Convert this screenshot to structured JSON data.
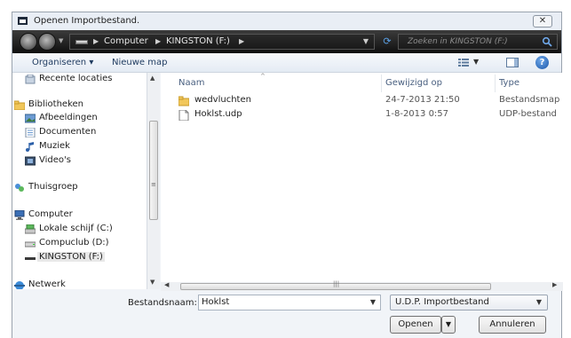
{
  "window": {
    "title": "Openen Importbestand.",
    "close_label": "✕"
  },
  "address": {
    "segments": [
      "Computer",
      "KINGSTON (F:)"
    ],
    "search_placeholder": "Zoeken in KINGSTON (F:)"
  },
  "toolbar": {
    "organize_label": "Organiseren ▾",
    "new_folder_label": "Nieuwe map"
  },
  "nav": {
    "items": [
      {
        "label": "Recente locaties",
        "icon": "recent-places-icon"
      },
      {
        "label": "Bibliotheken",
        "icon": "libraries-icon"
      },
      {
        "label": "Afbeeldingen",
        "icon": "pictures-icon"
      },
      {
        "label": "Documenten",
        "icon": "documents-icon"
      },
      {
        "label": "Muziek",
        "icon": "music-icon"
      },
      {
        "label": "Video's",
        "icon": "videos-icon"
      },
      {
        "label": "Thuisgroep",
        "icon": "homegroup-icon"
      },
      {
        "label": "Computer",
        "icon": "computer-icon"
      },
      {
        "label": "Lokale schijf (C:)",
        "icon": "local-disk-icon"
      },
      {
        "label": "Compuclub (D:)",
        "icon": "drive-icon"
      },
      {
        "label": "KINGSTON (F:)",
        "icon": "usb-drive-icon"
      },
      {
        "label": "Netwerk",
        "icon": "network-icon"
      }
    ]
  },
  "files": {
    "columns": [
      "Naam",
      "Gewijzigd op",
      "Type"
    ],
    "rows": [
      {
        "name": "wedvluchten",
        "modified": "24-7-2013 21:50",
        "type": "Bestandsmap",
        "icon": "folder-icon"
      },
      {
        "name": "Hoklst.udp",
        "modified": "1-8-2013 0:57",
        "type": "UDP-bestand",
        "icon": "file-icon"
      }
    ]
  },
  "footer": {
    "filename_label": "Bestandsnaam:",
    "filename_value": "Hoklst",
    "filetype_value": "U.D.P. Importbestand",
    "open_label": "Openen",
    "cancel_label": "Annuleren"
  },
  "colors": {
    "accent": "#1a56a8",
    "address_bar": "#1f1f1f",
    "window_bg": "#f1f4f8"
  }
}
